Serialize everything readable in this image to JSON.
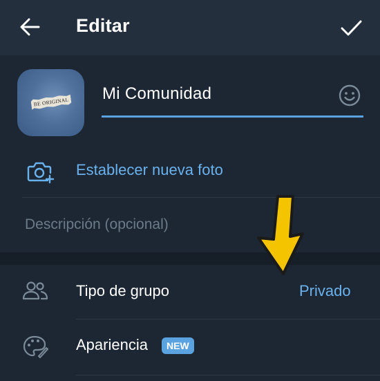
{
  "header": {
    "title": "Editar",
    "back_icon": "arrow-left-icon",
    "confirm_icon": "checkmark-icon"
  },
  "group": {
    "avatar_text": "BE ORIGINAL",
    "name_value": "Mi Comunidad",
    "emoji_icon": "smiley-icon"
  },
  "photo": {
    "label": "Establecer nueva foto",
    "icon": "camera-add-icon"
  },
  "description": {
    "placeholder": "Descripción (opcional)",
    "value": ""
  },
  "settings": {
    "group_type": {
      "label": "Tipo de grupo",
      "value": "Privado",
      "icon": "users-icon"
    },
    "appearance": {
      "label": "Apariencia",
      "badge": "NEW",
      "icon": "palette-icon"
    }
  },
  "annotation": {
    "icon": "yellow-arrow-down-icon"
  },
  "colors": {
    "background": "#1d2733",
    "header": "#232f3c",
    "accent": "#6ab2ee",
    "underline": "#5aa3e0",
    "section_gap": "#161e28",
    "arrow": "#f5c400"
  }
}
